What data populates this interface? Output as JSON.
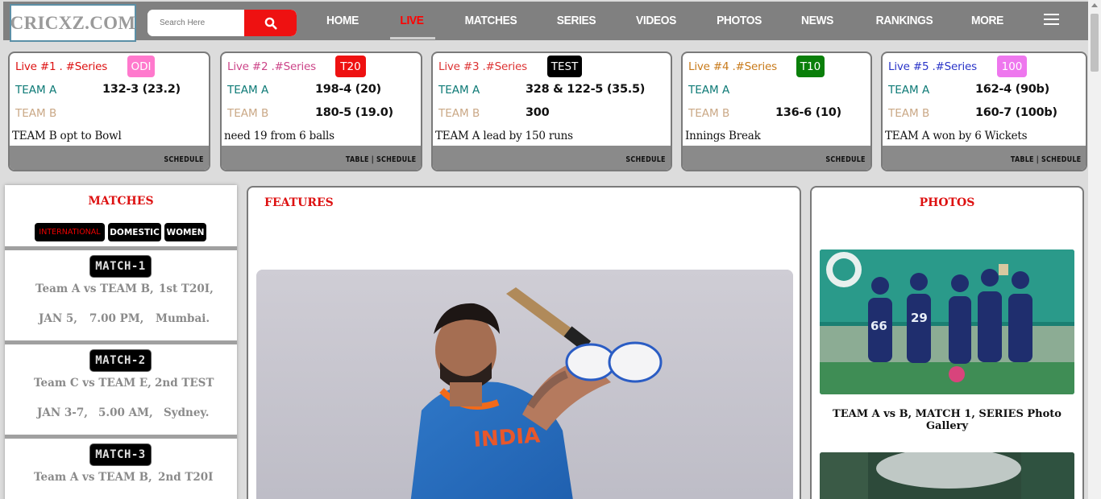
{
  "header": {
    "logo": "CRICXZ.COM",
    "search_placeholder": "Search Here",
    "search_icon": "search-icon",
    "nav": [
      "HOME",
      "LIVE",
      "MATCHES",
      "SERIES",
      "VIDEOS",
      "PHOTOS",
      "NEWS",
      "RANKINGS",
      "MORE"
    ],
    "active_nav": "LIVE",
    "menu_icon": "hamburger-menu-icon"
  },
  "live_cards": [
    {
      "title": "Live #1 . #Series",
      "title_color": "#dd1111",
      "format": "ODI",
      "format_bg": "#ff79cd",
      "format_color": "#ffffff",
      "team_a": "TEAM A",
      "score_a": "132-3 (23.2)",
      "team_b": "TEAM B",
      "score_b": "",
      "status": "TEAM B opt to Bowl",
      "links": "SCHEDULE"
    },
    {
      "title": "Live #2 .#Series",
      "title_color": "#cc4488",
      "format": "T20",
      "format_bg": "#ee1111",
      "format_color": "#ffffff",
      "team_a": "TEAM A",
      "score_a": "198-4 (20)",
      "team_b": "TEAM B",
      "score_b": "180-5 (19.0)",
      "status": "need 19 from 6 balls",
      "links": "TABLE | SCHEDULE"
    },
    {
      "title": "Live #3 .#Series",
      "title_color": "#dd3333",
      "format": "TEST",
      "format_bg": "#000000",
      "format_color": "#ffffff",
      "team_a": "TEAM A",
      "score_a": "328 & 122-5 (35.5)",
      "team_b": "TEAM B",
      "score_b": "300",
      "status": "TEAM A lead by 150 runs",
      "links": "SCHEDULE"
    },
    {
      "title": "Live #4 .#Series",
      "title_color": "#c87a1a",
      "format": "T10",
      "format_bg": "#0a7f0a",
      "format_color": "#ffffff",
      "team_a": "TEAM A",
      "score_a": "",
      "team_b": "TEAM B",
      "score_b": "136-6 (10)",
      "status": "Innings Break",
      "links": "SCHEDULE"
    },
    {
      "title": "Live #5 .#Series",
      "title_color": "#2a34c8",
      "format": "100",
      "format_bg": "#ee77ee",
      "format_color": "#ffffff",
      "team_a": "TEAM A",
      "score_a": "162-4 (90b)",
      "team_b": "TEAM B",
      "score_b": "160-7 (100b)",
      "status": "TEAM A won by 6 Wickets",
      "links": "TABLE | SCHEDULE"
    }
  ],
  "matches": {
    "heading": "MATCHES",
    "tabs": [
      "INTERNATIONAL",
      "DOMESTIC",
      "WOMEN"
    ],
    "active_tab": "INTERNATIONAL",
    "items": [
      {
        "label": "MATCH-1",
        "teams": "Team A vs TEAM B,",
        "type": "1st T20I,",
        "date": "JAN 5,",
        "time": "7.00 PM,",
        "venue": "Mumbai."
      },
      {
        "label": "MATCH-2",
        "teams": "Team C vs TEAM E,",
        "type": "2nd TEST",
        "date": "JAN 3-7,",
        "time": "5.00 AM,",
        "venue": "Sydney."
      },
      {
        "label": "MATCH-3",
        "teams": "Team A vs TEAM B,",
        "type": "2nd T20I",
        "date": "",
        "time": "",
        "venue": ""
      }
    ]
  },
  "features": {
    "heading": "FEATURES"
  },
  "photos": {
    "heading": "PHOTOS",
    "caption": "TEAM A vs B, MATCH 1, SERIES Photo Gallery"
  }
}
